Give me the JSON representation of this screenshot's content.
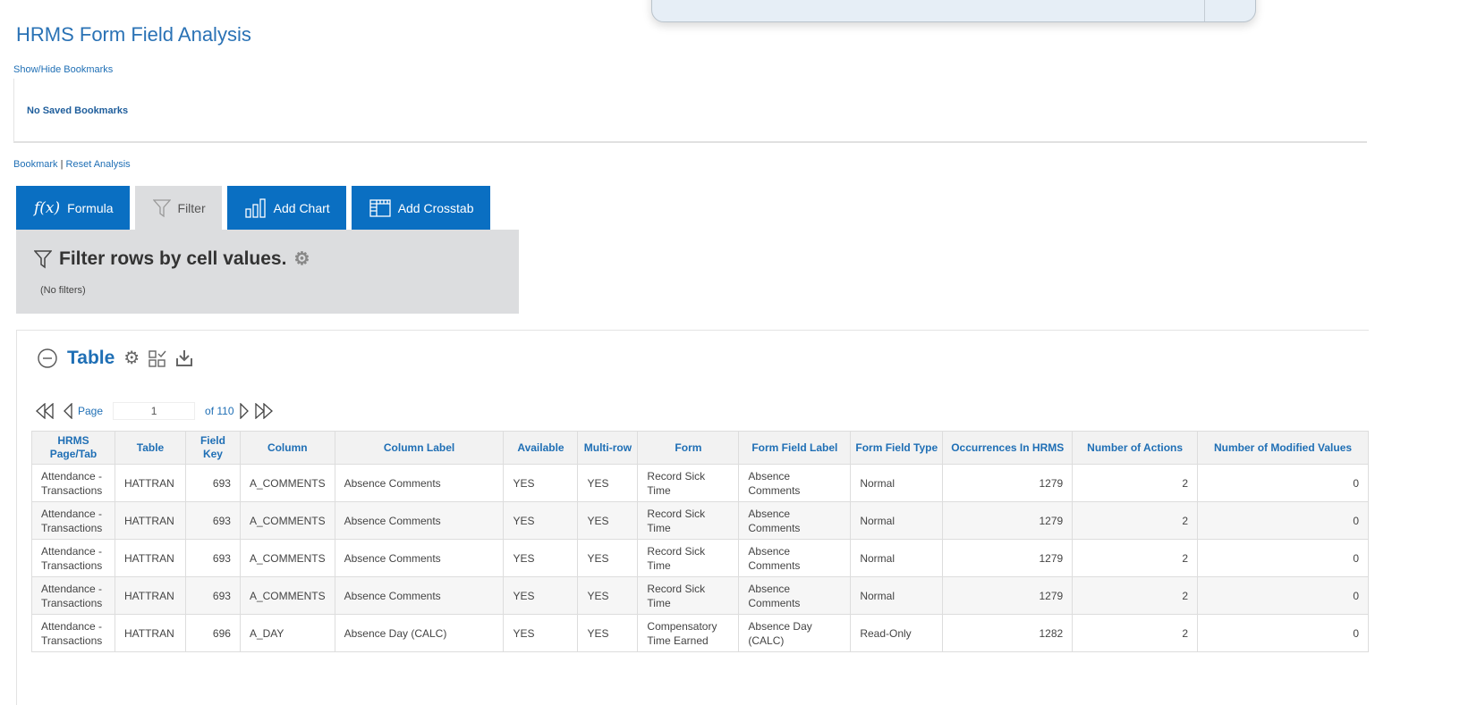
{
  "title": "HRMS Form Field Analysis",
  "bookmarks": {
    "toggle": "Show/Hide Bookmarks",
    "empty": "No Saved Bookmarks",
    "bookmark": "Bookmark",
    "separator": " | ",
    "reset": "Reset Analysis"
  },
  "tabs": [
    {
      "label": "Formula",
      "icon": "function-icon"
    },
    {
      "label": "Filter",
      "icon": "filter-icon"
    },
    {
      "label": "Add Chart",
      "icon": "bar-chart-icon"
    },
    {
      "label": "Add Crosstab",
      "icon": "crosstab-icon"
    }
  ],
  "filter": {
    "title": "Filter rows by cell values.",
    "empty": "(No filters)"
  },
  "table": {
    "title": "Table",
    "pager": {
      "page_label": "Page",
      "page": "1",
      "of": "of 110"
    },
    "headers": [
      "HRMS Page/Tab",
      "Table",
      "Field Key",
      "Column",
      "Column Label",
      "Available",
      "Multi-row",
      "Form",
      "Form Field Label",
      "Form Field Type",
      "Occurrences In HRMS",
      "Number of Actions",
      "Number of Modified Values"
    ],
    "rows": [
      [
        "Attendance - Transactions",
        "HATTRAN",
        "693",
        "A_COMMENTS",
        "Absence Comments",
        "YES",
        "YES",
        "Record Sick Time",
        "Absence Comments",
        "Normal",
        "1279",
        "2",
        "0"
      ],
      [
        "Attendance - Transactions",
        "HATTRAN",
        "693",
        "A_COMMENTS",
        "Absence Comments",
        "YES",
        "YES",
        "Record Sick Time",
        "Absence Comments",
        "Normal",
        "1279",
        "2",
        "0"
      ],
      [
        "Attendance - Transactions",
        "HATTRAN",
        "693",
        "A_COMMENTS",
        "Absence Comments",
        "YES",
        "YES",
        "Record Sick Time",
        "Absence Comments",
        "Normal",
        "1279",
        "2",
        "0"
      ],
      [
        "Attendance - Transactions",
        "HATTRAN",
        "693",
        "A_COMMENTS",
        "Absence Comments",
        "YES",
        "YES",
        "Record Sick Time",
        "Absence Comments",
        "Normal",
        "1279",
        "2",
        "0"
      ],
      [
        "Attendance - Transactions",
        "HATTRAN",
        "696",
        "A_DAY",
        "Absence Day (CALC)",
        "YES",
        "YES",
        "Compensatory Time Earned",
        "Absence Day (CALC)",
        "Read-Only",
        "1282",
        "2",
        "0"
      ]
    ]
  },
  "colors": {
    "accent": "#0a6fc2",
    "link": "#1f6fb5",
    "panel": "#dcdddf"
  }
}
